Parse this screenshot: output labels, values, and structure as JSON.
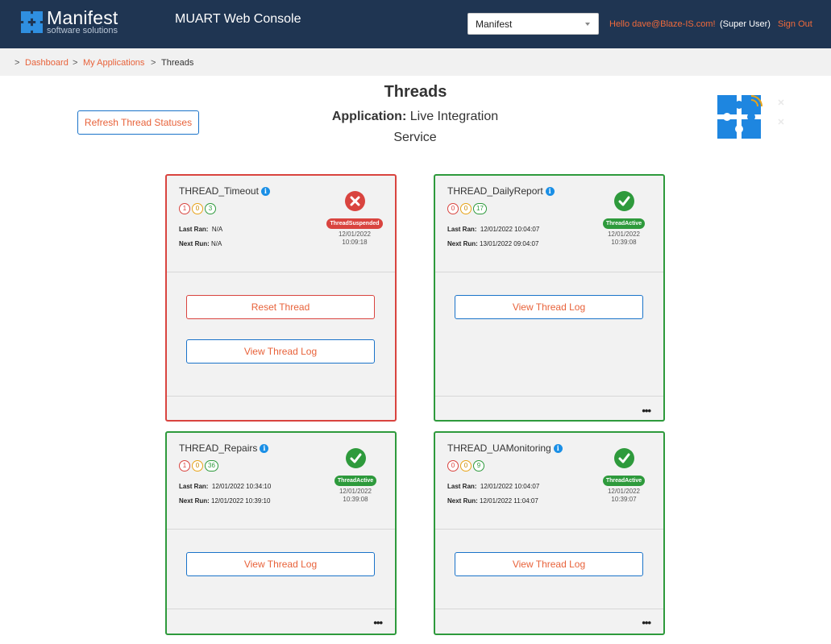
{
  "header": {
    "logo_main": "Manifest",
    "logo_sub": "software solutions",
    "app_title": "MUART Web Console",
    "select_value": "Manifest",
    "hello": "Hello dave@Blaze-IS.com!",
    "role": "(Super User)",
    "signout": "Sign Out"
  },
  "breadcrumb": {
    "sep": ">",
    "dashboard": "Dashboard",
    "my_apps": "My Applications",
    "current": "Threads"
  },
  "page": {
    "title": "Threads",
    "app_label": "Application:",
    "app_name": "Live Integration Service",
    "refresh": "Refresh Thread Statuses"
  },
  "threads": [
    {
      "name": "THREAD_Timeout",
      "counts": [
        "1",
        "0",
        "3"
      ],
      "last_ran_label": "Last Ran:",
      "last_ran": "N/A",
      "next_run_label": "Next Run:",
      "next_run": "N/A",
      "status": "ThreadSuspended",
      "stamp_date": "12/01/2022",
      "stamp_time": "10:09:18",
      "reset": "Reset Thread",
      "log": "View Thread Log"
    },
    {
      "name": "THREAD_DailyReport",
      "counts": [
        "0",
        "0",
        "17"
      ],
      "last_ran_label": "Last Ran:",
      "last_ran": "12/01/2022 10:04:07",
      "next_run_label": "Next Run:",
      "next_run": "13/01/2022 09:04:07",
      "status": "ThreadActive",
      "stamp_date": "12/01/2022",
      "stamp_time": "10:39:08",
      "log": "View Thread Log",
      "more": "•••"
    },
    {
      "name": "THREAD_Repairs",
      "counts": [
        "1",
        "0",
        "36"
      ],
      "last_ran_label": "Last Ran:",
      "last_ran": "12/01/2022 10:34:10",
      "next_run_label": "Next Run:",
      "next_run": "12/01/2022 10:39:10",
      "status": "ThreadActive",
      "stamp_date": "12/01/2022",
      "stamp_time": "10:39:08",
      "log": "View Thread Log",
      "more": "•••"
    },
    {
      "name": "THREAD_UAMonitoring",
      "counts": [
        "0",
        "0",
        "9"
      ],
      "last_ran_label": "Last Ran:",
      "last_ran": "12/01/2022 10:04:07",
      "next_run_label": "Next Run:",
      "next_run": "12/01/2022 11:04:07",
      "status": "ThreadActive",
      "stamp_date": "12/01/2022",
      "stamp_time": "10:39:07",
      "log": "View Thread Log",
      "more": "•••"
    }
  ]
}
